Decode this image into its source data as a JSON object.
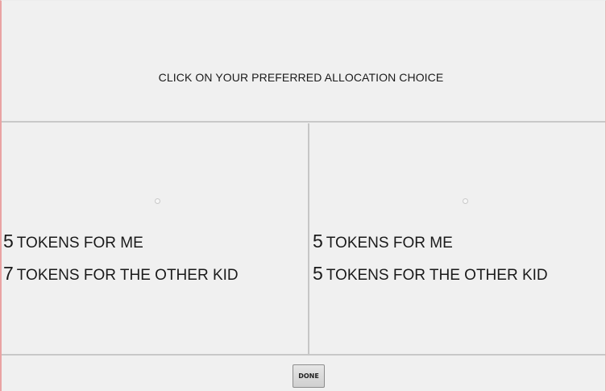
{
  "header": {
    "instruction": "CLICK ON YOUR PREFERRED ALLOCATION CHOICE"
  },
  "options": [
    {
      "me_count": "5",
      "me_label": "TOKENS FOR ME",
      "other_count": "7",
      "other_label": "TOKENS FOR THE OTHER KID",
      "selected": false
    },
    {
      "me_count": "5",
      "me_label": "TOKENS FOR ME",
      "other_count": "5",
      "other_label": "TOKENS FOR THE OTHER KID",
      "selected": false
    }
  ],
  "footer": {
    "done_label": "DONE"
  },
  "colors": {
    "background": "#f0f0f0",
    "divider": "#c8c8c8",
    "text": "#1a1a1a",
    "left_border": "#e9a3a3"
  }
}
